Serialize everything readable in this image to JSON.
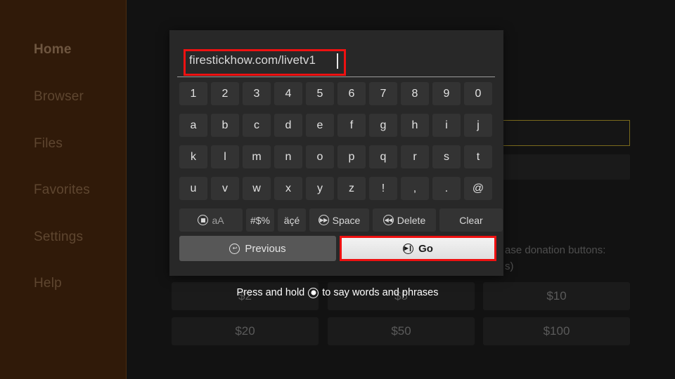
{
  "sidebar": {
    "items": [
      {
        "label": "Home",
        "active": true
      },
      {
        "label": "Browser",
        "active": false
      },
      {
        "label": "Files",
        "active": false
      },
      {
        "label": "Favorites",
        "active": false
      },
      {
        "label": "Settings",
        "active": false
      },
      {
        "label": "Help",
        "active": false
      }
    ]
  },
  "background": {
    "partial_text_line1": "ase donation buttons:",
    "partial_text_line2": "s)",
    "donation_buttons": [
      "$2",
      "$5",
      "$10",
      "$20",
      "$50",
      "$100"
    ],
    "field_border_color": "#7a6a1c"
  },
  "voice_hint": {
    "text_before": "Press and hold",
    "text_after": "to say words and phrases",
    "icon": "voice-circle-icon"
  },
  "keyboard": {
    "url_value": "firestickhow.com/livetv1",
    "url_focus_color": "#ee1111",
    "rows": [
      [
        "1",
        "2",
        "3",
        "4",
        "5",
        "6",
        "7",
        "8",
        "9",
        "0"
      ],
      [
        "a",
        "b",
        "c",
        "d",
        "e",
        "f",
        "g",
        "h",
        "i",
        "j"
      ],
      [
        "k",
        "l",
        "m",
        "n",
        "o",
        "p",
        "q",
        "r",
        "s",
        "t"
      ],
      [
        "u",
        "v",
        "w",
        "x",
        "y",
        "z",
        "!",
        ",",
        ".",
        "@"
      ]
    ],
    "function_keys": [
      {
        "label": "aA",
        "icon": "stop-circle-icon"
      },
      {
        "label": "#$%",
        "icon": null
      },
      {
        "label": "äçé",
        "icon": null
      },
      {
        "label": "Space",
        "icon": "fast-forward-circle-icon"
      },
      {
        "label": "Delete",
        "icon": "rewind-circle-icon"
      },
      {
        "label": "Clear",
        "icon": null
      }
    ],
    "previous_label": "Previous",
    "previous_icon": "back-circle-icon",
    "go_label": "Go",
    "go_icon": "play-pause-circle-icon"
  }
}
